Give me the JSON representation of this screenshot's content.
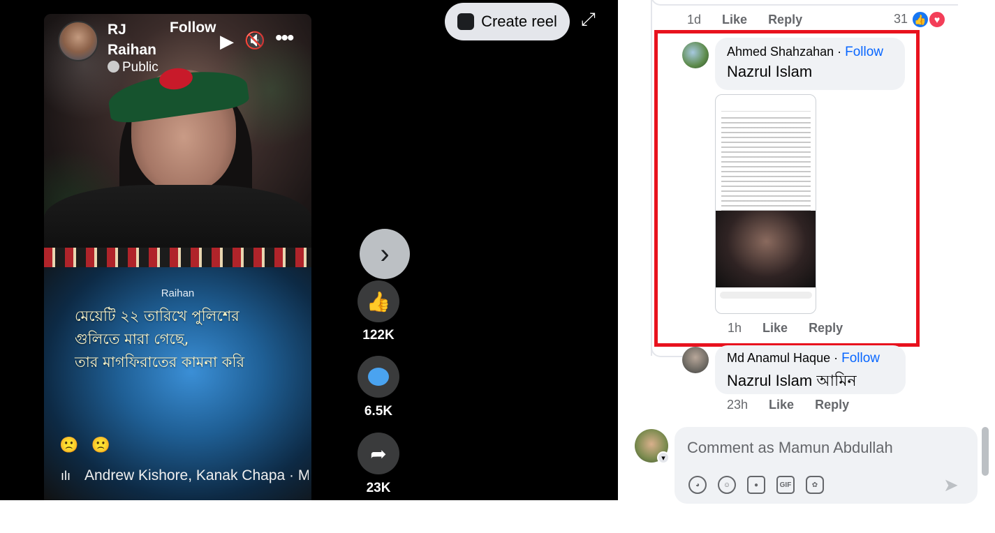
{
  "reel": {
    "author": "RJ Raihan",
    "follow_label": "Follow",
    "privacy": "Public",
    "overlay_name": "Raihan",
    "caption_lines": [
      "মেয়েটি ২২ তারিখে পুলিশের",
      "গুলিতে মারা গেছে,",
      "তার মাগফিরাতের কামনা করি"
    ],
    "emoji_text": "🙁 🙁",
    "music": "Andrew Kishore, Kanak Chapa · M",
    "create_reel_label": "Create reel",
    "actions": {
      "likes": "122K",
      "comments": "6.5K",
      "shares": "23K"
    }
  },
  "comments": {
    "top_meta": {
      "time": "1d",
      "like": "Like",
      "reply": "Reply",
      "reaction_count": "31"
    },
    "highlighted": {
      "name": "Ahmed Shahzahan",
      "separator": " · ",
      "follow": "Follow",
      "text": "Nazrul Islam",
      "time": "1h",
      "like": "Like",
      "reply": "Reply"
    },
    "next": {
      "name": "Md Anamul Haque",
      "separator": " · ",
      "follow": "Follow",
      "tag": "Nazrul Islam",
      "text": " আমিন",
      "time": "23h",
      "like": "Like",
      "reply": "Reply"
    },
    "composer": {
      "placeholder": "Comment as Mamun Abdullah",
      "gif_label": "GIF"
    }
  },
  "colors": {
    "accent": "#0866ff",
    "highlight_border": "#e8121e",
    "like_blue": "#1877f2",
    "love_red": "#f33e58"
  }
}
